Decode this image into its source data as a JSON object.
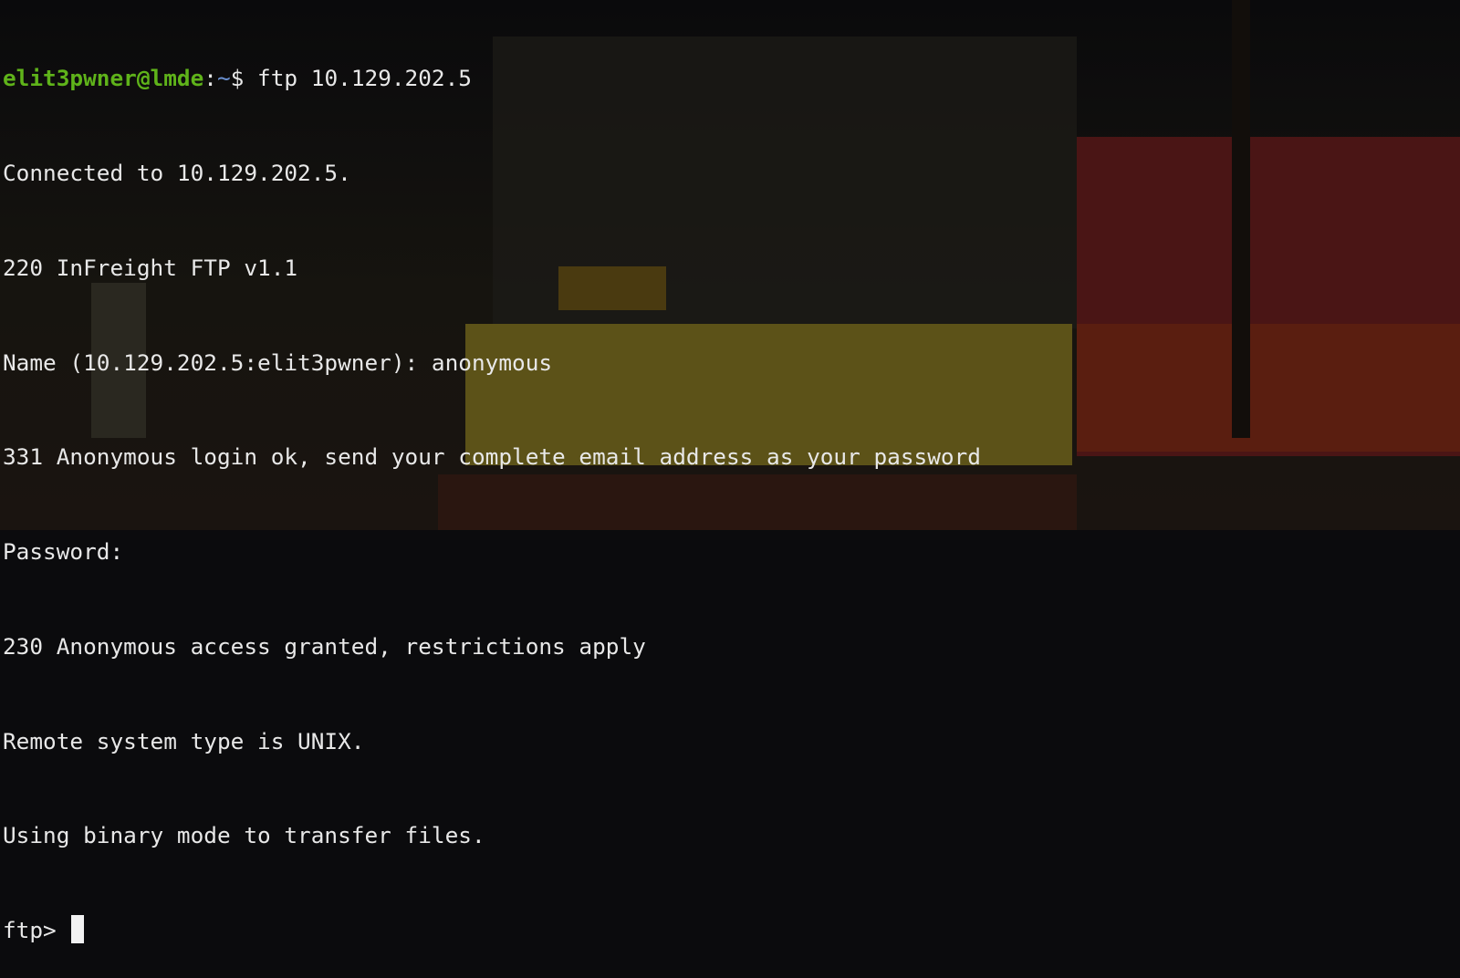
{
  "prompt": {
    "user_host": "elit3pwner@lmde",
    "separator": ":",
    "path": "~",
    "symbol": "$ ",
    "command": "ftp 10.129.202.5"
  },
  "output": [
    "Connected to 10.129.202.5.",
    "220 InFreight FTP v1.1",
    "Name (10.129.202.5:elit3pwner): anonymous",
    "331 Anonymous login ok, send your complete email address as your password",
    "Password:",
    "230 Anonymous access granted, restrictions apply",
    "Remote system type is UNIX.",
    "Using binary mode to transfer files."
  ],
  "ftp_prompt": "ftp> ",
  "colors": {
    "user_host": "#5fb31a",
    "path": "#6a8fd0",
    "text": "#e8e8e8",
    "background": "#0b0b0d"
  }
}
